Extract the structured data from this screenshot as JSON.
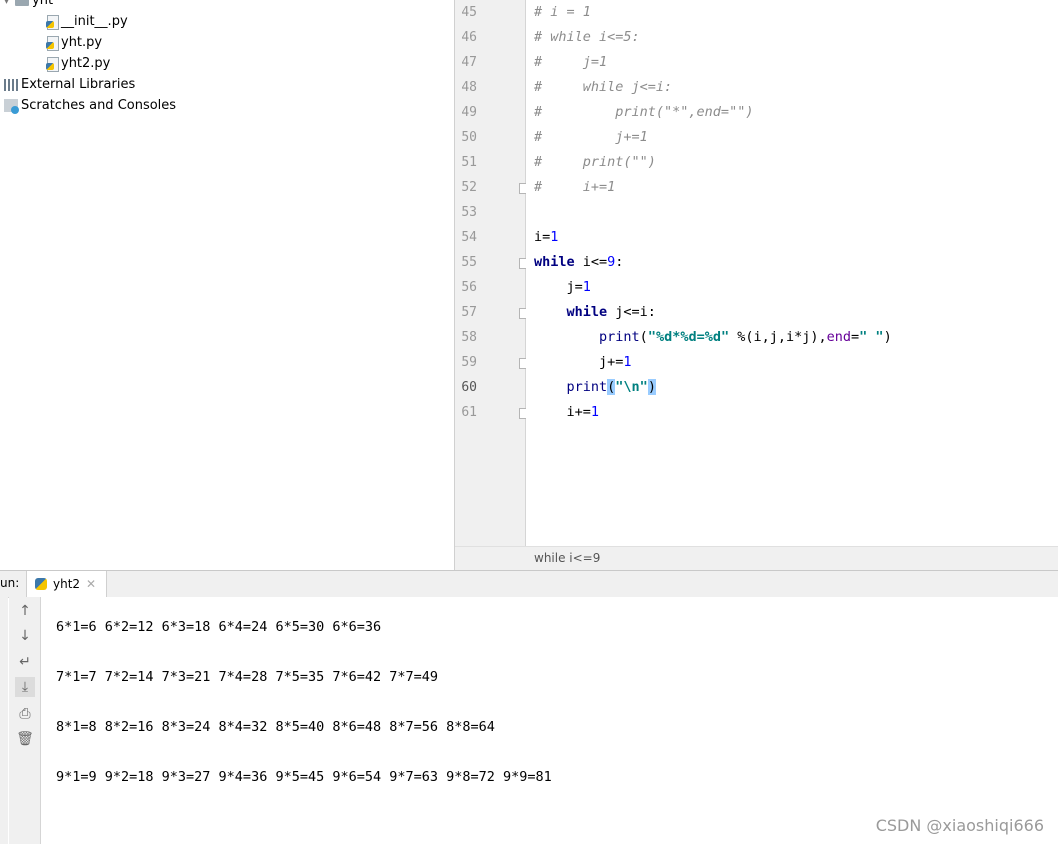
{
  "project_tree": {
    "items": [
      {
        "label": "yht",
        "kind": "folder"
      },
      {
        "label": "__init__.py",
        "kind": "python-file"
      },
      {
        "label": "yht.py",
        "kind": "python-file"
      },
      {
        "label": "yht2.py",
        "kind": "python-file"
      },
      {
        "label": "External Libraries",
        "kind": "libraries"
      },
      {
        "label": "Scratches and Consoles",
        "kind": "scratches"
      }
    ]
  },
  "editor": {
    "line_numbers": [
      "45",
      "46",
      "47",
      "48",
      "49",
      "50",
      "51",
      "52",
      "53",
      "54",
      "55",
      "56",
      "57",
      "58",
      "59",
      "60",
      "61"
    ],
    "current_line": "60",
    "lines": [
      "# i = 1",
      "# while i<=5:",
      "#     j=1",
      "#     while j<=i:",
      "#         print(\"*\",end=\"\")",
      "#         j+=1",
      "#     print(\"\")",
      "#     i+=1",
      "",
      "i=1",
      "while i<=9:",
      "    j=1",
      "    while j<=i:",
      "        print(\"%d*%d=%d\" %(i,j,i*j),end=\" \")",
      "        j+=1",
      "    print(\"\\n\")",
      "    i+=1"
    ],
    "breadcrumb": "while i<=9"
  },
  "run_panel": {
    "label": "un:",
    "tab_title": "yht2",
    "output": [
      "6*1=6 6*2=12 6*3=18 6*4=24 6*5=30 6*6=36",
      "7*1=7 7*2=14 7*3=21 7*4=28 7*5=35 7*6=42 7*7=49",
      "8*1=8 8*2=16 8*3=24 8*4=32 8*5=40 8*6=48 8*7=56 8*8=64",
      "9*1=9 9*2=18 9*3=27 9*4=36 9*5=45 9*6=54 9*7=63 9*8=72 9*9=81"
    ],
    "toolbar_icons": [
      "arrow-up-icon",
      "arrow-down-icon",
      "soft-wrap-icon",
      "scroll-to-end-icon",
      "print-icon",
      "trash-icon"
    ]
  },
  "watermark": "CSDN @xiaoshiqi666",
  "colors": {
    "keyword": "#000080",
    "number": "#0000ff",
    "string": "#008080",
    "comment": "#8c8c8c",
    "current_line": "#fcfaed"
  }
}
